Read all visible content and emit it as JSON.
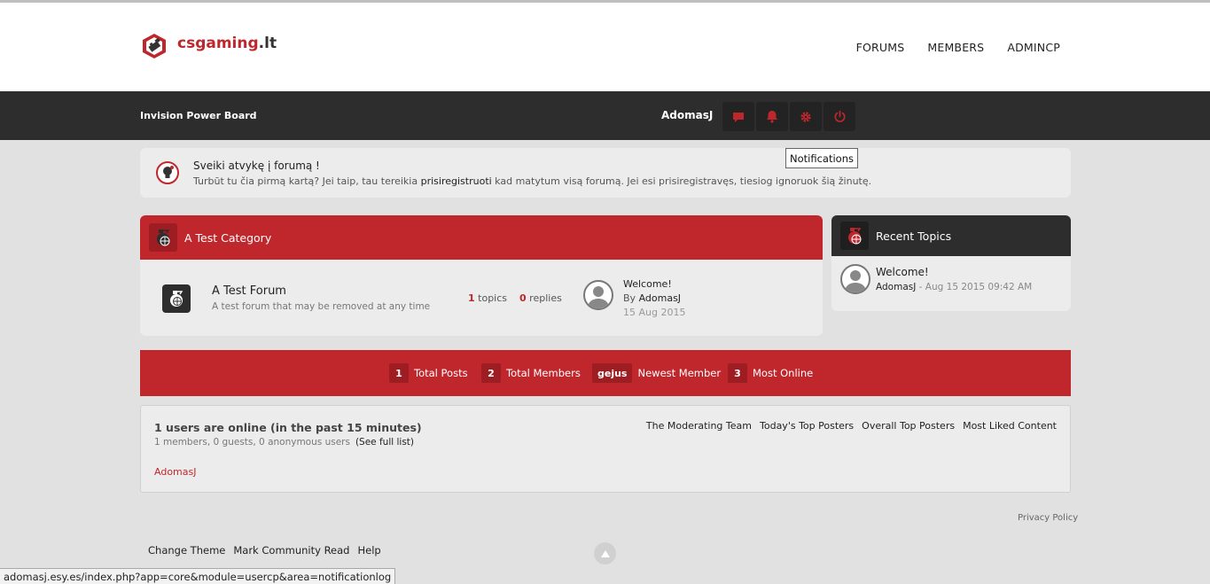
{
  "header": {
    "logo_main": "csgaming",
    "logo_tld": ".lt",
    "nav": [
      "FORUMS",
      "MEMBERS",
      "ADMINCP"
    ]
  },
  "userbar": {
    "board_name": "Invision Power Board",
    "username": "AdomasJ",
    "tooltip": "Notifications"
  },
  "welcome": {
    "title": "Sveiki atvykę į forumą !",
    "text_before": "Turbūt tu čia pirmą kartą? Jei taip, tau tereikia ",
    "link": "prisiregistruoti",
    "text_after": " kad matytum visą forumą. Jei esi prisiregistravęs, tiesiog ignoruok šią žinutę."
  },
  "category": {
    "title": "A Test Category",
    "forum": {
      "title": "A Test Forum",
      "description": "A test forum that may be removed at any time",
      "topics": "1",
      "topics_label": " topics",
      "replies": "0",
      "replies_label": "replies",
      "last_post_title": "Welcome!",
      "last_post_by_prefix": "By ",
      "last_post_author": "AdomasJ",
      "last_post_date": "15 Aug 2015"
    }
  },
  "recent": {
    "title": "Recent Topics",
    "topic_title": "Welcome!",
    "topic_author": "AdomasJ",
    "topic_date": " - Aug 15 2015 09:42 AM"
  },
  "stats": [
    {
      "num": "1",
      "label": "Total Posts"
    },
    {
      "num": "2",
      "label": "Total Members"
    },
    {
      "num": "gejus",
      "label": "Newest Member"
    },
    {
      "num": "3",
      "label": "Most Online"
    }
  ],
  "online": {
    "title": "1 users are online (in the past 15 minutes)",
    "sub": "1 members, 0 guests, 0 anonymous users",
    "full_list": "(See full list)",
    "user": "AdomasJ",
    "links": [
      "The Moderating Team",
      "Today's Top Posters",
      "Overall Top Posters",
      "Most Liked Content"
    ]
  },
  "footer": {
    "privacy": "Privacy Policy",
    "links": [
      "Change Theme",
      "Mark Community Read",
      "Help"
    ]
  },
  "statusbar": "adomasj.esy.es/index.php?app=core&module=usercp&area=notificationlog",
  "colors": {
    "accent": "#c0272d",
    "dark": "#2d2d2d",
    "background": "#e1e1e1"
  }
}
